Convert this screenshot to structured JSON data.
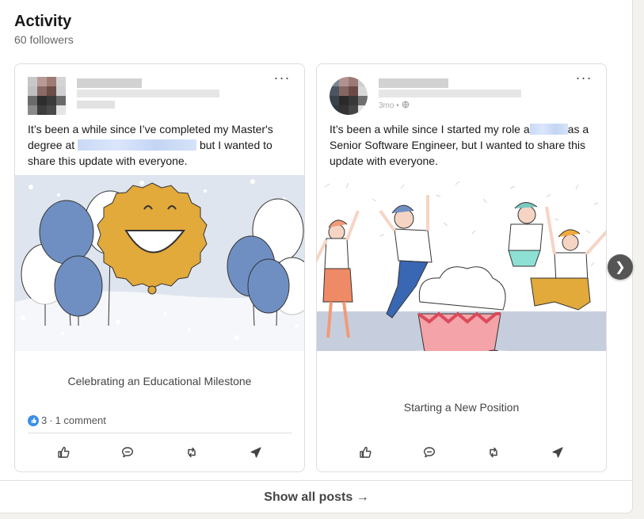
{
  "section": {
    "title": "Activity",
    "followers": "60 followers"
  },
  "posts": [
    {
      "text_before": "It’s been a while since I’ve completed my Master's degree at",
      "text_after": "but I wanted to share this update with everyone.",
      "caption": "Celebrating an Educational Milestone",
      "reaction_count": "3",
      "comments": "1 comment"
    },
    {
      "meta_visible": "3mo •",
      "text_before": "It’s been a while since I started my role a",
      "text_after": "as a Senior Software Engineer, but I wanted to share this update with everyone.",
      "caption": "Starting a New Position"
    }
  ],
  "icons": {
    "more": "more-horizontal-icon",
    "like": "thumbs-up-icon",
    "comment": "comment-icon",
    "repost": "repost-icon",
    "send": "send-icon",
    "next": "chevron-right-icon"
  },
  "colors": {
    "accent_blue": "#378fe9",
    "balloon_blue": "#6f8fc3",
    "medal_gold": "#e2a93b",
    "cupcake_pink": "#f4a3a8",
    "cherry_red": "#e05260"
  },
  "footer": {
    "show_all": "Show all posts →"
  }
}
